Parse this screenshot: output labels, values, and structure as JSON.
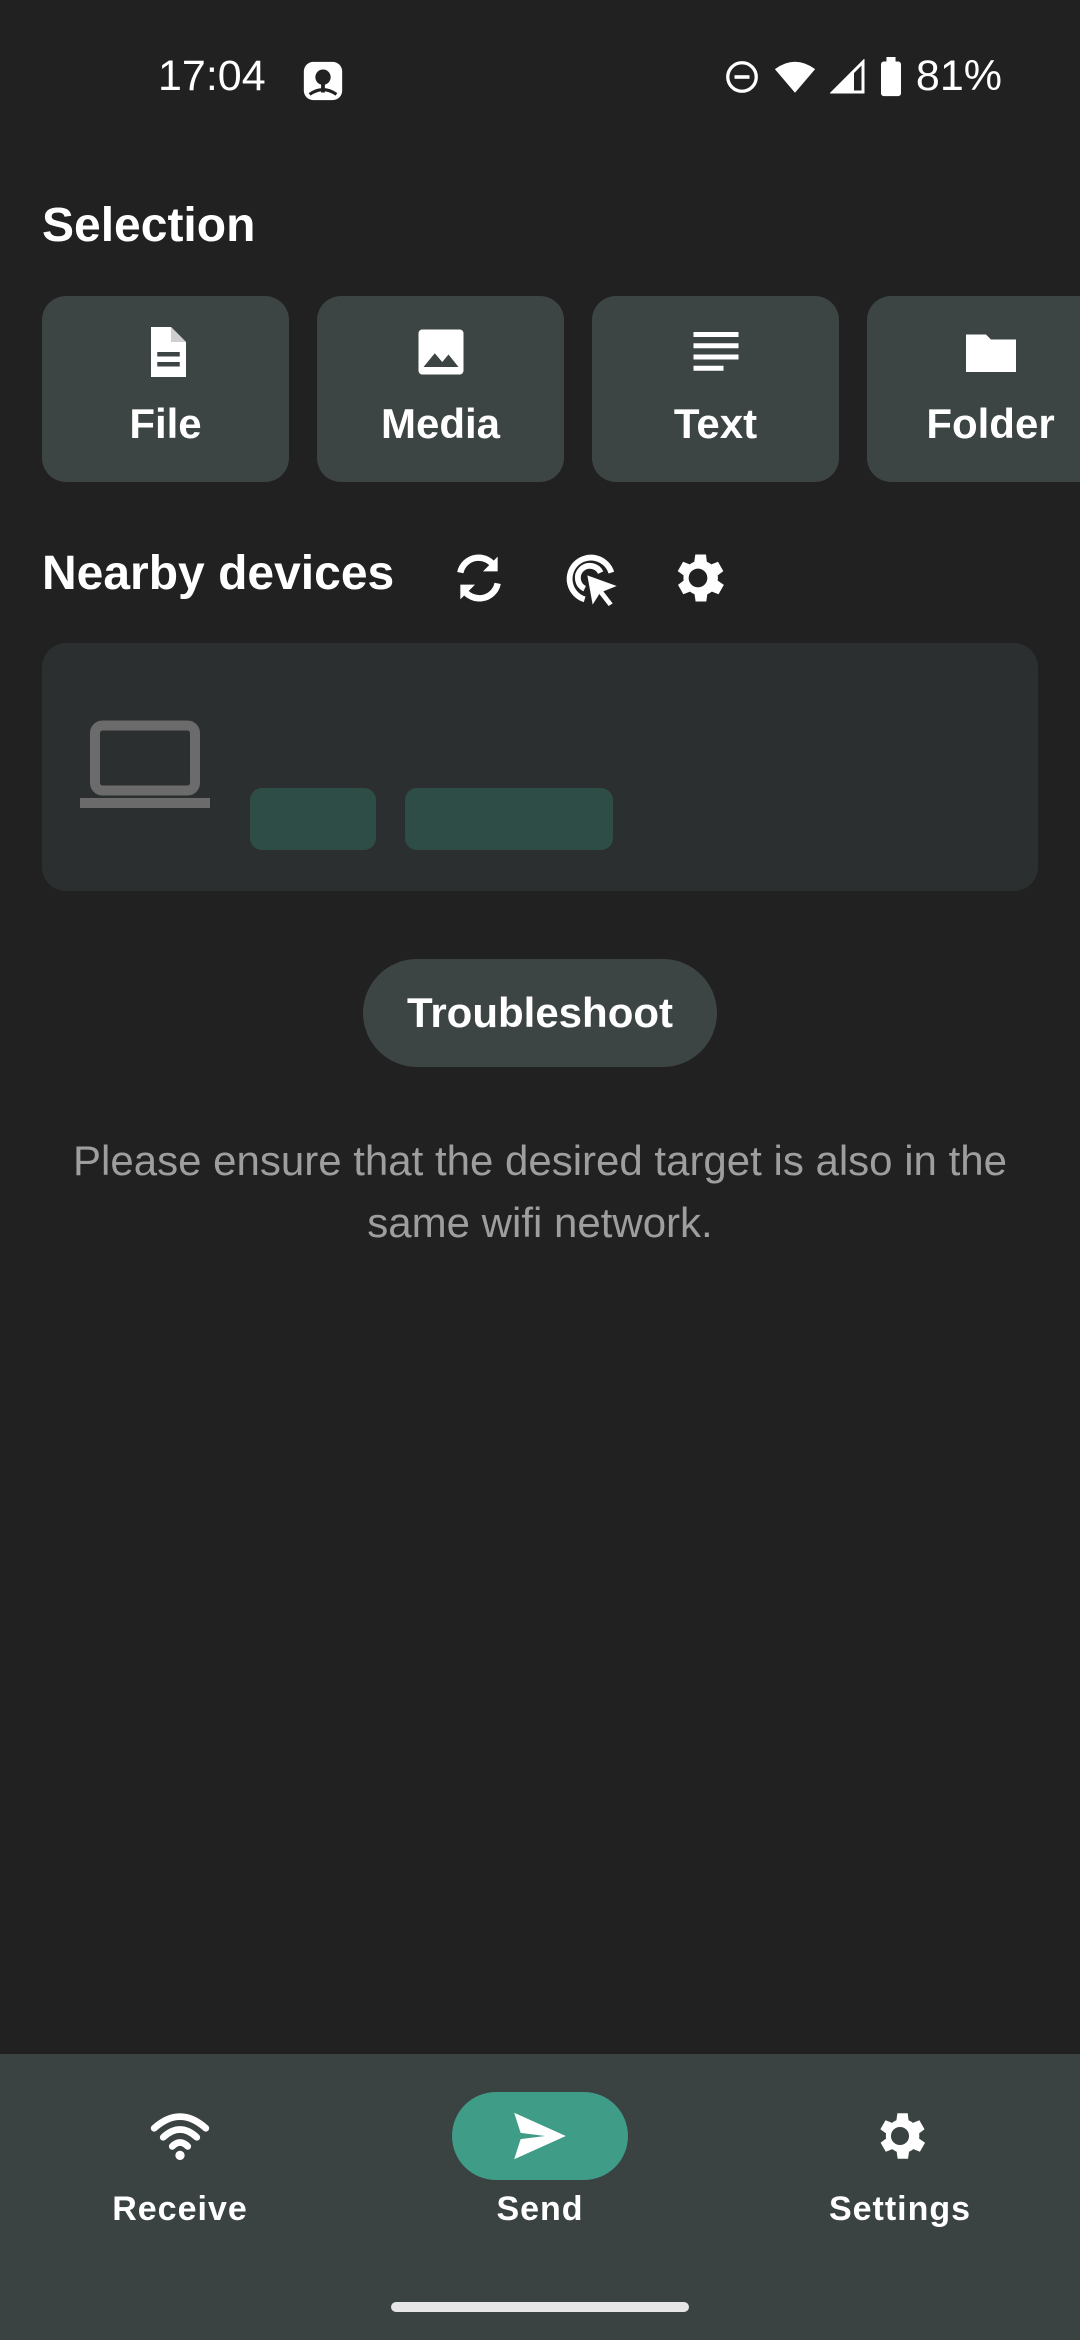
{
  "status_bar": {
    "time": "17:04",
    "battery": "81%",
    "icons": [
      "photos-app-icon",
      "dnd-icon",
      "wifi-icon",
      "signal-icon",
      "battery-icon"
    ]
  },
  "selection": {
    "title": "Selection",
    "items": [
      {
        "label": "File",
        "icon": "file-icon"
      },
      {
        "label": "Media",
        "icon": "image-icon"
      },
      {
        "label": "Text",
        "icon": "text-lines-icon"
      },
      {
        "label": "Folder",
        "icon": "folder-icon"
      }
    ]
  },
  "nearby": {
    "title": "Nearby devices",
    "actions": [
      "refresh-icon",
      "select-target-icon",
      "gear-icon"
    ]
  },
  "troubleshoot": {
    "label": "Troubleshoot"
  },
  "hint": "Please ensure that the desired target is also in the same wifi network.",
  "bottom_nav": {
    "items": [
      {
        "label": "Receive",
        "icon": "wifi-icon"
      },
      {
        "label": "Send",
        "icon": "send-icon",
        "active": true
      },
      {
        "label": "Settings",
        "icon": "gear-icon"
      }
    ]
  },
  "colors": {
    "background": "#212121",
    "card": "#3d4444",
    "accent": "#3f9c86",
    "nav_bg": "#3a4242",
    "hint_text": "#9e9e9e"
  }
}
